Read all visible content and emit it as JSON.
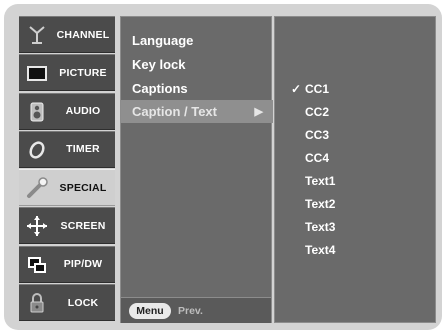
{
  "left_menu": {
    "items": [
      {
        "label": "CHANNEL",
        "icon": "channel-antenna-icon",
        "active": false
      },
      {
        "label": "PICTURE",
        "icon": "picture-tv-icon",
        "active": false
      },
      {
        "label": "AUDIO",
        "icon": "audio-speaker-icon",
        "active": false
      },
      {
        "label": "TIMER",
        "icon": "timer-clock-icon",
        "active": false
      },
      {
        "label": "SPECIAL",
        "icon": "special-wrench-icon",
        "active": true
      },
      {
        "label": "SCREEN",
        "icon": "screen-move-arrows-icon",
        "active": false
      },
      {
        "label": "PIP/DW",
        "icon": "pip-windows-icon",
        "active": false
      },
      {
        "label": "LOCK",
        "icon": "lock-padlock-icon",
        "active": false
      }
    ]
  },
  "submenu": {
    "items": [
      {
        "label": "Language"
      },
      {
        "label": "Key lock"
      },
      {
        "label": "Captions"
      },
      {
        "label": "Caption / Text",
        "selected": true,
        "arrow": "▶"
      }
    ],
    "footer": {
      "menu_label": "Menu",
      "prev_label": "Prev."
    }
  },
  "options": {
    "check_symbol": "✓",
    "items": [
      {
        "label": "CC1",
        "checked": true
      },
      {
        "label": "CC2",
        "checked": false
      },
      {
        "label": "CC3",
        "checked": false
      },
      {
        "label": "CC4",
        "checked": false
      },
      {
        "label": "Text1",
        "checked": false
      },
      {
        "label": "Text2",
        "checked": false
      },
      {
        "label": "Text3",
        "checked": false
      },
      {
        "label": "Text4",
        "checked": false
      }
    ]
  },
  "colors": {
    "frame": "#d3d3d3",
    "menu_item": "#4b4b4b",
    "menu_item_active": "#cfcfcf",
    "panel": "#6a6a6a",
    "selected_row": "#8f8f8f"
  }
}
